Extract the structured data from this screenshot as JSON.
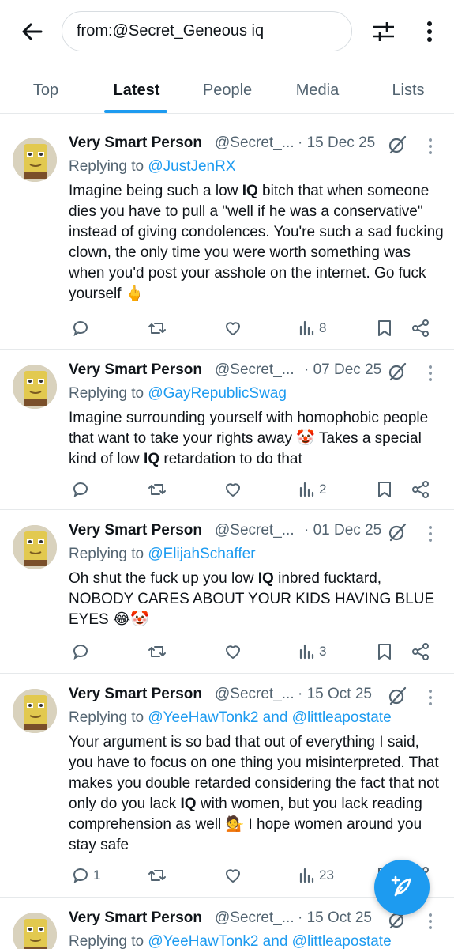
{
  "search": {
    "query": "from:@Secret_Geneous iq"
  },
  "tabs": [
    {
      "label": "Top"
    },
    {
      "label": "Latest"
    },
    {
      "label": "People"
    },
    {
      "label": "Media"
    },
    {
      "label": "Lists"
    }
  ],
  "active_tab": "Latest",
  "tweets": [
    {
      "name": "Very Smart Person",
      "handle": "@Secret_...",
      "date": "· 15 Dec 25",
      "replying_prefix": "Replying to ",
      "replying_to": "@JustJenRX",
      "text_parts": [
        "Imagine being such a low ",
        "IQ",
        " bitch that when someone dies you have to pull a \"well if he was a conservative\" instead of giving condolences. You're such a sad fucking clown, the only time you were worth something was when you'd post your asshole on the internet. Go fuck yourself 🖕"
      ],
      "replies": "",
      "views": "8"
    },
    {
      "name": "Very Smart Person",
      "handle": "@Secret_...",
      "date": "· 07 Dec 25",
      "replying_prefix": "Replying to ",
      "replying_to": "@GayRepublicSwag",
      "text_parts": [
        "Imagine surrounding yourself with homophobic people that want to take your rights away 🤡 Takes a special kind of low ",
        "IQ",
        " retardation to do that"
      ],
      "replies": "",
      "views": "2"
    },
    {
      "name": "Very Smart Person",
      "handle": "@Secret_...",
      "date": "· 01 Dec 25",
      "replying_prefix": "Replying to ",
      "replying_to": "@ElijahSchaffer",
      "text_parts": [
        "Oh shut the fuck up you low ",
        "IQ",
        " inbred fucktard, NOBODY CARES ABOUT YOUR KIDS HAVING BLUE EYES 😂🤡"
      ],
      "replies": "",
      "views": "3"
    },
    {
      "name": "Very Smart Person",
      "handle": "@Secret_...",
      "date": "· 15 Oct 25",
      "replying_prefix": "Replying to ",
      "replying_to": "@YeeHawTonk2 and @littleapostate",
      "text_parts": [
        "Your argument is so bad that out of everything I said, you have to focus on one thing you misinterpreted. That makes you double retarded considering the fact that not only do you lack ",
        "IQ",
        " with women, but you lack reading comprehension as well 💁 I hope women around you stay safe"
      ],
      "replies": "1",
      "views": "23"
    },
    {
      "name": "Very Smart Person",
      "handle": "@Secret_...",
      "date": "· 15 Oct 25",
      "replying_prefix": "Replying to ",
      "replying_to": "@YeeHawTonk2 and @littleapostate",
      "text_parts": [
        "",
        "",
        ""
      ],
      "replies": "",
      "views": ""
    }
  ],
  "colors": {
    "accent": "#1d9bf0",
    "text_primary": "#0f1419",
    "text_secondary": "#536471",
    "divider": "#e6e9eb"
  },
  "icons": [
    "back-arrow-icon",
    "filter-sliders-icon",
    "more-vertical-icon",
    "grok-icon",
    "reply-icon",
    "retweet-icon",
    "like-icon",
    "views-icon",
    "bookmark-icon",
    "share-icon",
    "compose-feather-icon"
  ]
}
